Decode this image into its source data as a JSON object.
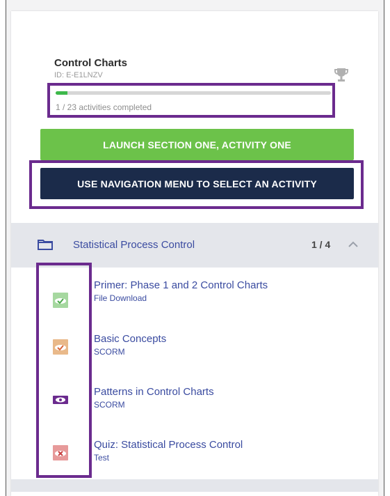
{
  "course": {
    "title": "Control Charts",
    "id_text": "ID: E-E1LNZV",
    "progress_text": "1 / 23 activities completed",
    "progress_fraction": 0.043
  },
  "buttons": {
    "launch_label": "LAUNCH SECTION ONE, ACTIVITY ONE",
    "nav_label": "USE NAVIGATION MENU TO SELECT AN ACTIVITY"
  },
  "section": {
    "title": "Statistical Process Control",
    "count": "1 / 4"
  },
  "activities": [
    {
      "title": "Primer: Phase 1 and 2 Control Charts",
      "type": "File Download",
      "icon": "file-download-check-icon",
      "icon_bg": "#a6d8a0"
    },
    {
      "title": "Basic Concepts",
      "type": "SCORM",
      "icon": "scorm-check-icon",
      "icon_bg": "#e9b98a"
    },
    {
      "title": "Patterns in Control Charts",
      "type": "SCORM",
      "icon": "scorm-eye-icon",
      "icon_bg": "#6b2b8e"
    },
    {
      "title": "Quiz: Statistical Process Control",
      "type": "Test",
      "icon": "test-fail-icon",
      "icon_bg": "#e79a9a"
    }
  ],
  "colors": {
    "accent_purple": "#6b2b8e",
    "launch_green": "#6cc24a",
    "nav_navy": "#1b2b4a",
    "link_blue": "#3a4ba0"
  }
}
